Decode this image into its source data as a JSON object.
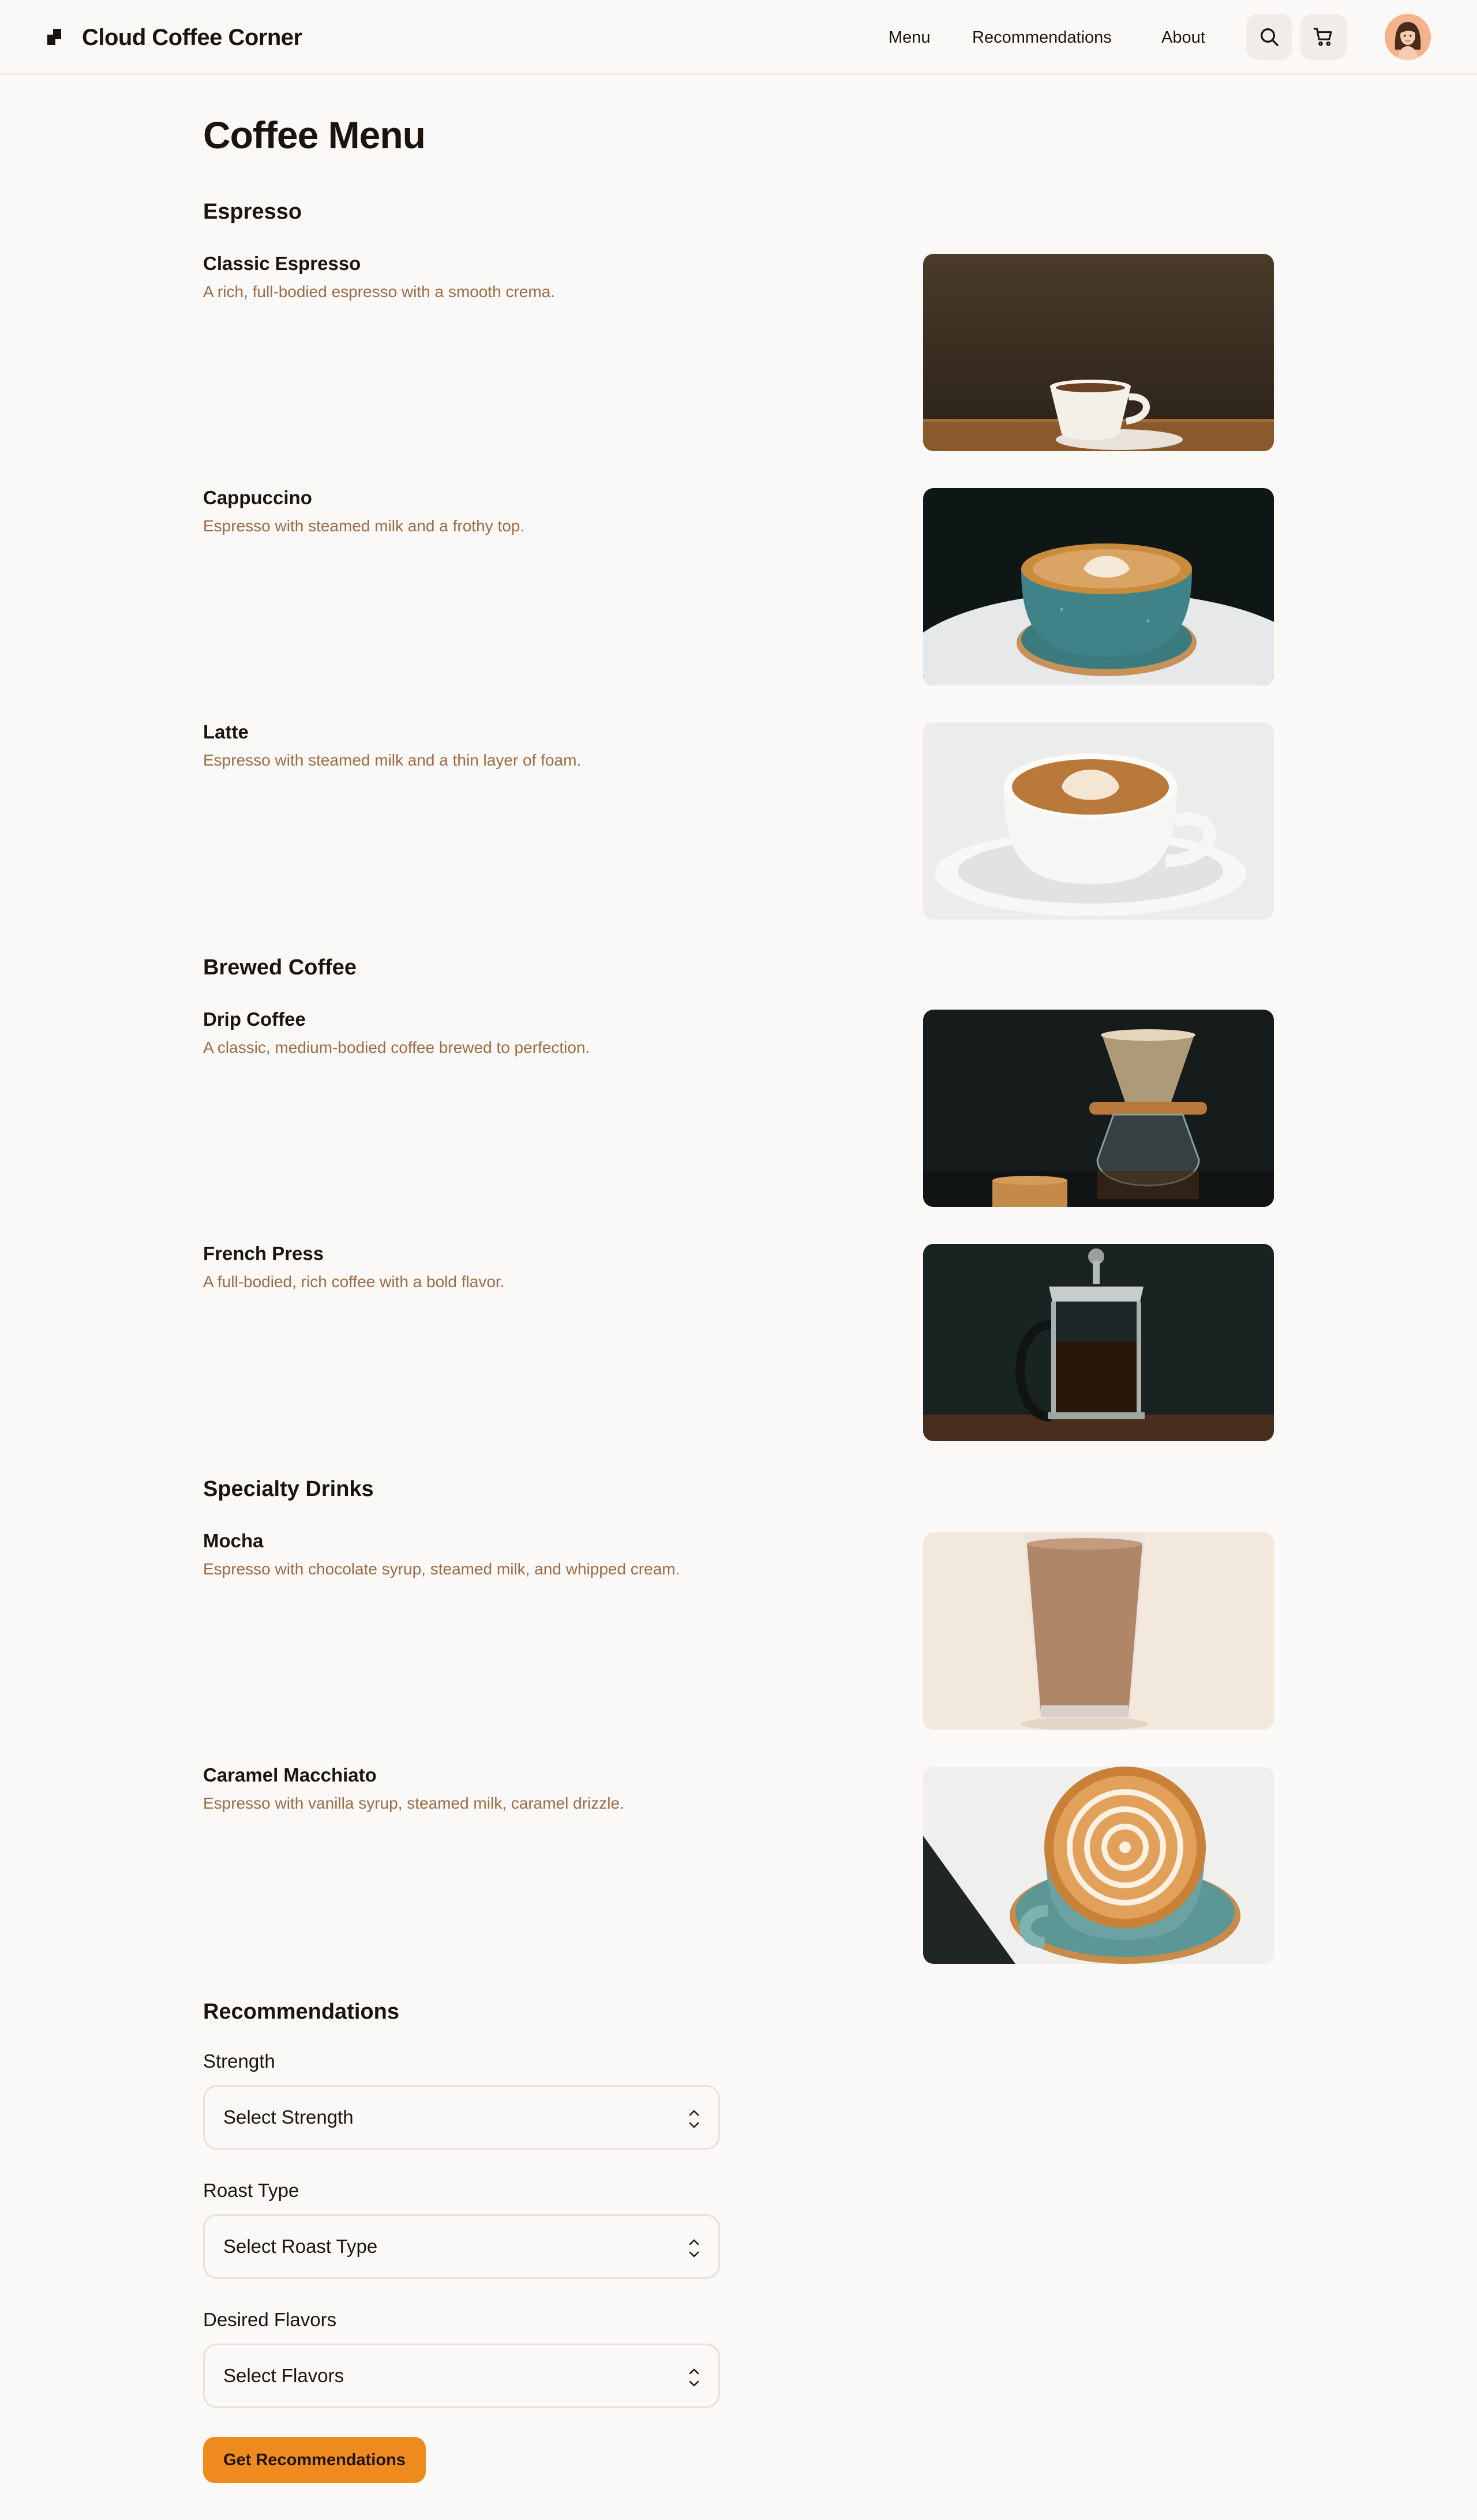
{
  "header": {
    "brand": "Cloud Coffee Corner",
    "nav": [
      "Menu",
      "Recommendations",
      "About"
    ],
    "search_icon": "search-icon",
    "cart_icon": "cart-icon"
  },
  "page_title": "Coffee Menu",
  "sections": [
    {
      "title": "Espresso",
      "items": [
        {
          "name": "Classic Espresso",
          "description": "A rich, full-bodied espresso with a smooth crema."
        },
        {
          "name": "Cappuccino",
          "description": "Espresso with steamed milk and a frothy top."
        },
        {
          "name": "Latte",
          "description": "Espresso with steamed milk and a thin layer of foam."
        }
      ]
    },
    {
      "title": "Brewed Coffee",
      "items": [
        {
          "name": "Drip Coffee",
          "description": "A classic, medium-bodied coffee brewed to perfection."
        },
        {
          "name": "French Press",
          "description": "A full-bodied, rich coffee with a bold flavor."
        }
      ]
    },
    {
      "title": "Specialty Drinks",
      "items": [
        {
          "name": "Mocha",
          "description": "Espresso with chocolate syrup, steamed milk, and whipped cream."
        },
        {
          "name": "Caramel Macchiato",
          "description": "Espresso with vanilla syrup, steamed milk, caramel drizzle."
        }
      ]
    }
  ],
  "recommendations": {
    "title": "Recommendations",
    "fields": [
      {
        "label": "Strength",
        "placeholder": "Select Strength"
      },
      {
        "label": "Roast Type",
        "placeholder": "Select Roast Type"
      },
      {
        "label": "Desired Flavors",
        "placeholder": "Select Flavors"
      }
    ],
    "button": "Get Recommendations"
  },
  "colors": {
    "accent": "#ef8a1f",
    "description_text": "#9c6b44",
    "background": "#fbf9f8"
  }
}
